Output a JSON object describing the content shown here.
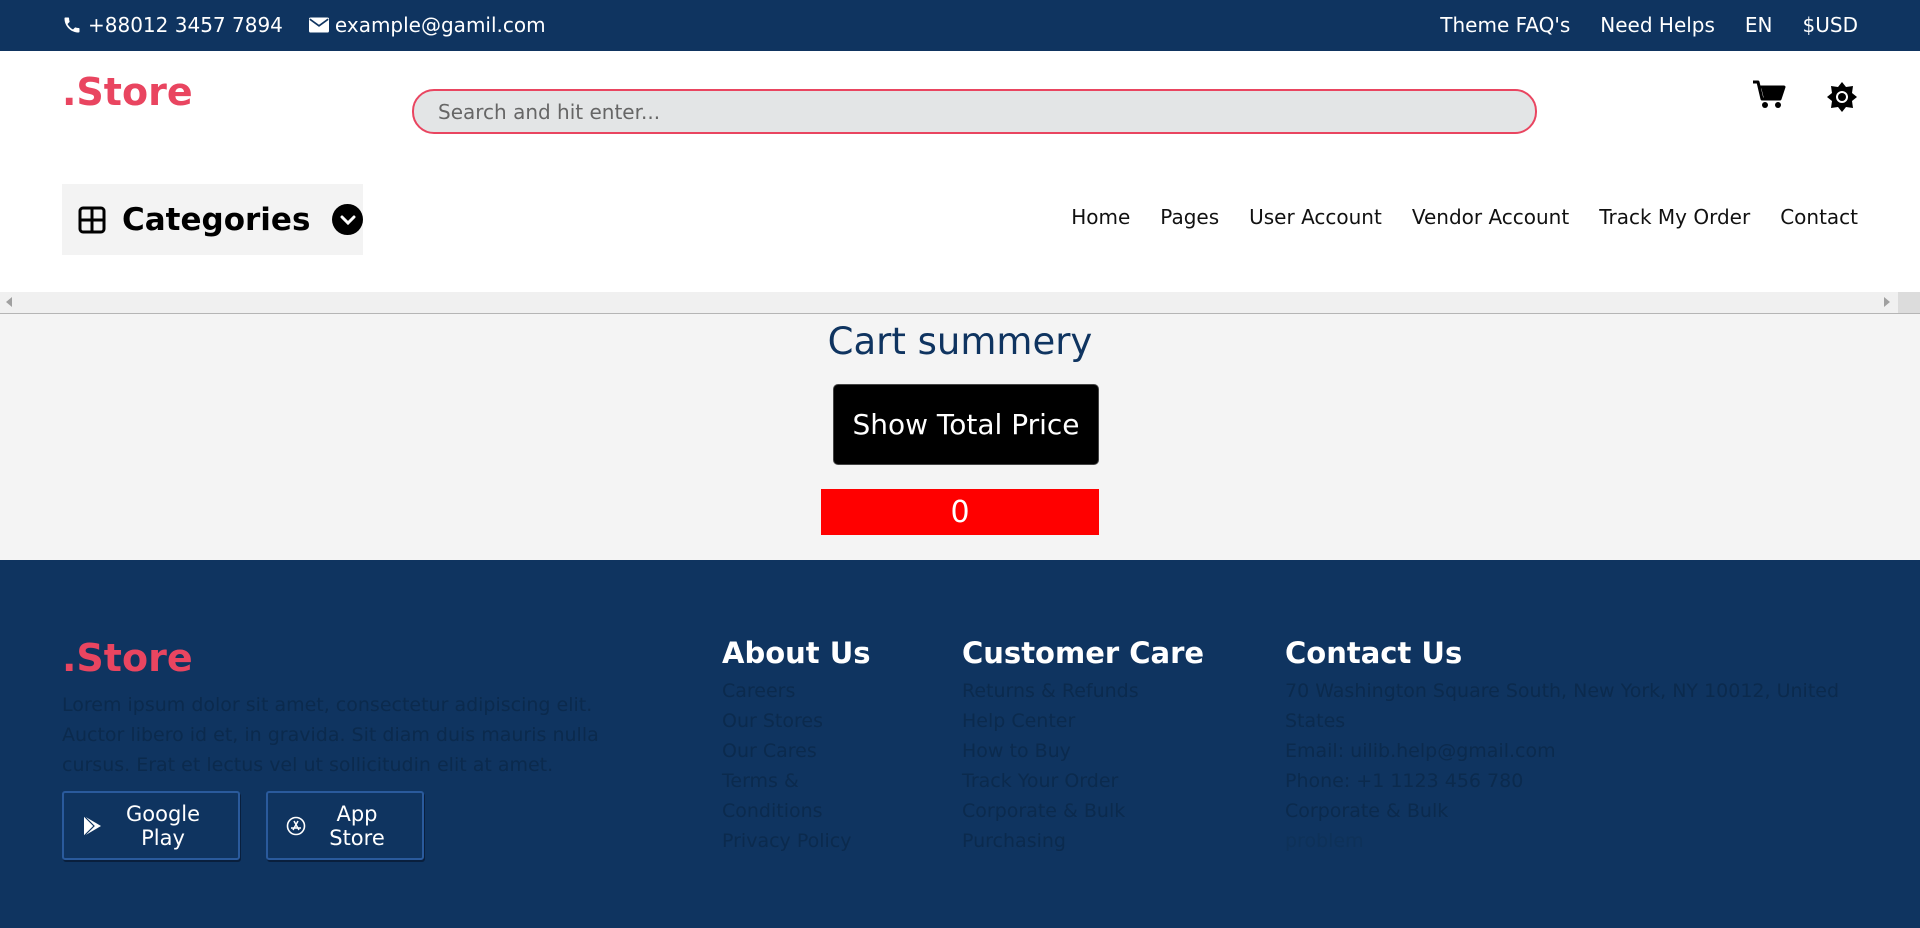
{
  "topbar": {
    "phone": "+88012 3457 7894",
    "email": "example@gamil.com",
    "links": [
      "Theme FAQ's",
      "Need Helps",
      "EN",
      "$USD"
    ]
  },
  "header": {
    "logo": ".Store",
    "search_placeholder": "Search and hit enter..."
  },
  "categories": {
    "label": "Categories"
  },
  "nav": [
    "Home",
    "Pages",
    "User Account",
    "Vendor Account",
    "Track My Order",
    "Contact"
  ],
  "cart_summary": {
    "title": "Cart summery",
    "button_label": "Show Total Price",
    "total": "0"
  },
  "footer": {
    "logo": ".Store",
    "description": "Lorem ipsum dolor sit amet, consectetur adipiscing elit. Auctor libero id et, in gravida. Sit diam duis mauris nulla cursus. Erat et lectus vel ut sollicitudin elit at amet.",
    "google_play": "Google Play",
    "app_store": "App Store",
    "about": {
      "title": "About Us",
      "items": [
        "Careers",
        "Our Stores",
        "Our Cares",
        "Terms &",
        "Conditions",
        "Privacy Policy"
      ]
    },
    "care": {
      "title": "Customer Care",
      "items": [
        "Returns & Refunds",
        "Help Center",
        "How to Buy",
        "Track Your Order",
        "Corporate & Bulk",
        "Purchasing"
      ]
    },
    "contact": {
      "title": "Contact Us",
      "items": [
        "70 Washington Square South, New York, NY 10012, United",
        "States",
        "Email: uilib.help@gmail.com",
        "Phone: +1 1123 456 780",
        "Corporate & Bulk",
        "problem"
      ]
    }
  },
  "colors": {
    "navy": "#0f3460",
    "accent": "#e94560",
    "total_bg": "#ff0000"
  }
}
